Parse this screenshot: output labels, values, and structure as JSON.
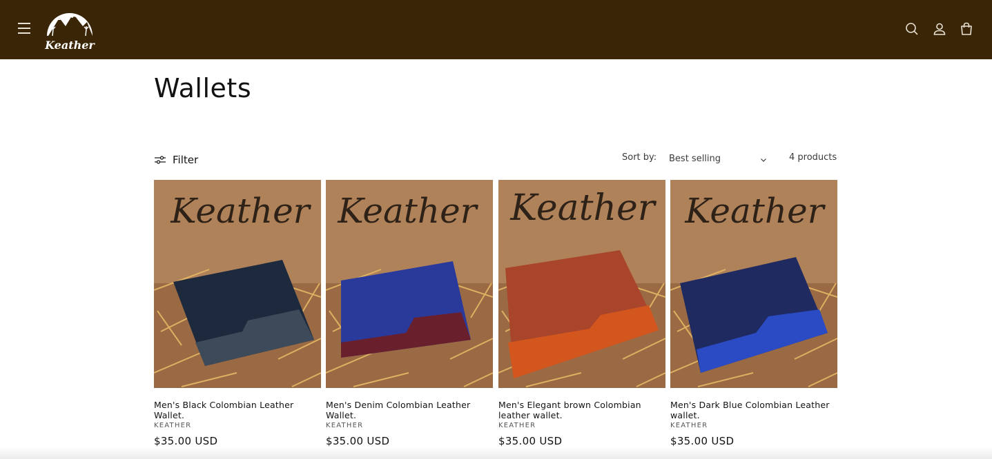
{
  "header": {
    "brand": "Keather",
    "menu_icon": "hamburger-menu-icon",
    "search_icon": "search-icon",
    "account_icon": "account-icon",
    "cart_icon": "cart-icon",
    "background": "#3a2606"
  },
  "collection": {
    "title": "Wallets",
    "filter_label": "Filter",
    "sort_label": "Sort by:",
    "sort_value": "Best selling",
    "product_count": "4 products"
  },
  "products": [
    {
      "title": "Men's Black Colombian Leather Wallet.",
      "vendor": "KEATHER",
      "price": "$35.00 USD",
      "image_brand": "Keather",
      "wallet_color": "#1d2a3d",
      "accent_color": "#3c4a5a"
    },
    {
      "title": "Men's Denim Colombian Leather Wallet.",
      "vendor": "KEATHER",
      "price": "$35.00 USD",
      "image_brand": "Keather",
      "wallet_color": "#2a3a9a",
      "accent_color": "#6a1f2c"
    },
    {
      "title": "Men's Elegant brown Colombian leather wallet.",
      "vendor": "KEATHER",
      "price": "$35.00 USD",
      "image_brand": "Keather",
      "wallet_color": "#a8452a",
      "accent_color": "#d4561f"
    },
    {
      "title": "Men's Dark Blue Colombian Leather wallet.",
      "vendor": "KEATHER",
      "price": "$35.00 USD",
      "image_brand": "Keather",
      "wallet_color": "#1f2a60",
      "accent_color": "#2a4bc4"
    }
  ]
}
